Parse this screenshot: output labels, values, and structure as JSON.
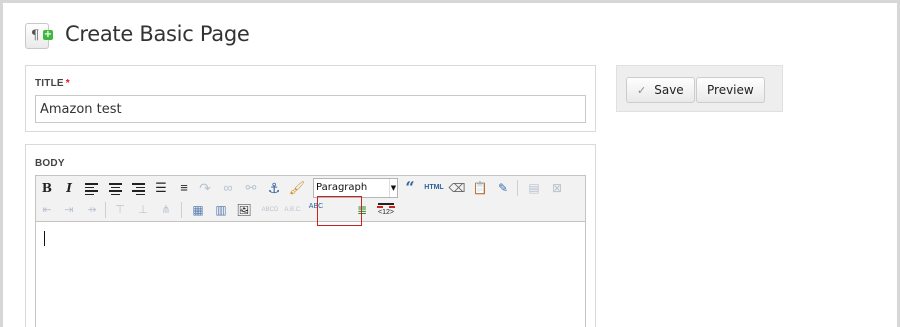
{
  "page": {
    "title": "Create Basic Page"
  },
  "title_field": {
    "label": "TITLE",
    "required_marker": "*",
    "value": "Amazon test"
  },
  "body_field": {
    "label": "BODY"
  },
  "toolbar": {
    "bold": "B",
    "italic": "I",
    "format_select": "Paragraph",
    "blockquote": "“",
    "html": "HTML",
    "pagebreak_label": "<12>",
    "abc": "ABC"
  },
  "actions": {
    "save": "Save",
    "preview": "Preview"
  },
  "colors": {
    "accent_red": "#c6241e",
    "amazon_orange": "#ff9900",
    "add_green": "#3cb83a"
  }
}
